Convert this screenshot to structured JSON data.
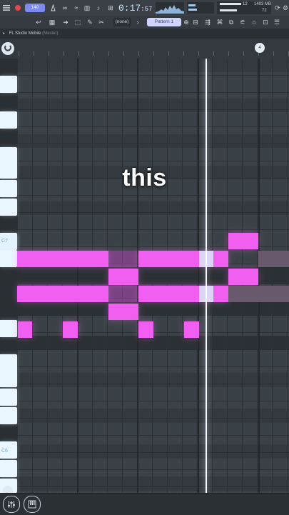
{
  "topbar": {
    "tempo": "140 ",
    "time_main": "0:17",
    "time_frac": ":57",
    "memory": "1403 MB",
    "cpu_count": "12",
    "voices": "72"
  },
  "toolbar2": {
    "preset": "(none)",
    "pattern": "Pattern 1"
  },
  "titlebar": {
    "title": "FL Studio Mobile",
    "subtitle": "(Master)"
  },
  "ruler": {
    "marker": "4"
  },
  "piano_roll": {
    "octave_labels": [
      "C7",
      "C6"
    ]
  },
  "overlay": {
    "caption": "this"
  },
  "colors": {
    "note": "#f05ff0",
    "playhead": "#f4f8ff",
    "background": "#2f3438"
  },
  "icons": [
    "record-icon",
    "metronome-icon",
    "loop-icon",
    "undo-icon",
    "settings-icon",
    "menu-icon",
    "snap-icon",
    "piano-icon",
    "mixer-icon"
  ]
}
